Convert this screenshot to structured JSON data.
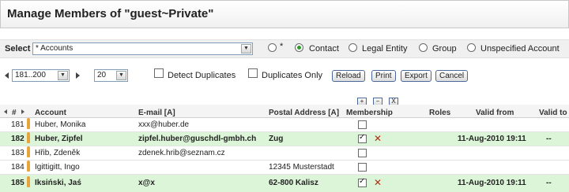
{
  "title": "Manage Members of \"guest~Private\"",
  "filter": {
    "select_label": "Select",
    "select_value": "* Accounts",
    "radios": [
      {
        "label": "*",
        "checked": false
      },
      {
        "label": "Contact",
        "checked": true
      },
      {
        "label": "Legal Entity",
        "checked": false
      },
      {
        "label": "Group",
        "checked": false
      },
      {
        "label": "Unspecified Account",
        "checked": false
      }
    ]
  },
  "paging": {
    "range": "181..200",
    "page_size": "20",
    "detect_duplicates": "Detect Duplicates",
    "duplicates_only": "Duplicates Only",
    "buttons": [
      "Reload",
      "Print",
      "Export",
      "Cancel"
    ]
  },
  "grid": {
    "columns": [
      "#",
      "Account",
      "E-mail [A]",
      "Postal Address [A]",
      "Membership",
      "Roles",
      "Valid from",
      "Valid to"
    ],
    "membership_controls": [
      "+",
      "−",
      "X"
    ],
    "rows": [
      {
        "num": "181",
        "account": "Huber, Monika",
        "email": "xxx@huber.de",
        "postal": "",
        "member": false,
        "removable": false,
        "valid_from": "",
        "valid_to": "",
        "highlight": false
      },
      {
        "num": "182",
        "account": "Huber, Zipfel",
        "email": "zipfel.huber@guschdl-gmbh.ch",
        "postal": "Zug",
        "member": true,
        "removable": true,
        "valid_from": "11-Aug-2010 19:11",
        "valid_to": "--",
        "highlight": true
      },
      {
        "num": "183",
        "account": "Hřib, Zdeněk",
        "email": "zdenek.hrib@seznam.cz",
        "postal": "",
        "member": false,
        "removable": false,
        "valid_from": "",
        "valid_to": "",
        "highlight": false
      },
      {
        "num": "184",
        "account": "Igittigitt, Ingo",
        "email": "",
        "postal": "12345 Musterstadt",
        "member": false,
        "removable": false,
        "valid_from": "",
        "valid_to": "",
        "highlight": false
      },
      {
        "num": "185",
        "account": "Iksiński, Jaś",
        "email": "x@x",
        "postal": "62-800 Kalisz",
        "member": true,
        "removable": true,
        "valid_from": "11-Aug-2010 19:11",
        "valid_to": "--",
        "highlight": true
      }
    ]
  }
}
